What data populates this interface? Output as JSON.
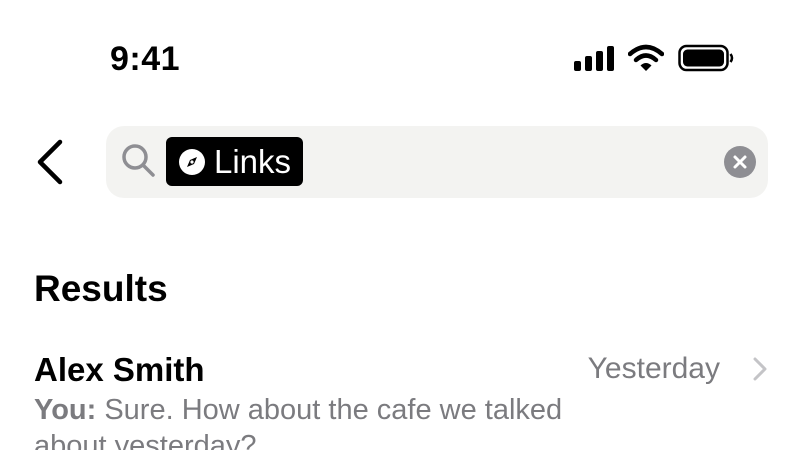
{
  "status_bar": {
    "time": "9:41",
    "icons": [
      "cellular-signal-icon",
      "wifi-icon",
      "battery-icon"
    ]
  },
  "search": {
    "back_icon": "chevron-left-icon",
    "search_icon": "magnifying-glass-icon",
    "token": {
      "icon": "compass-icon",
      "label": "Links"
    },
    "clear_icon": "clear-circle-icon"
  },
  "results": {
    "title": "Results",
    "items": [
      {
        "name": "Alex Smith",
        "date": "Yesterday",
        "preview_sender": "You:",
        "preview_text": " Sure. How about the cafe we talked about yesterday?"
      }
    ]
  },
  "colors": {
    "background": "#ffffff",
    "search_bar": "#f3f3f1",
    "token_background": "#000000",
    "secondary_text": "#7b7b7f",
    "clear_button": "#8e8e93"
  }
}
